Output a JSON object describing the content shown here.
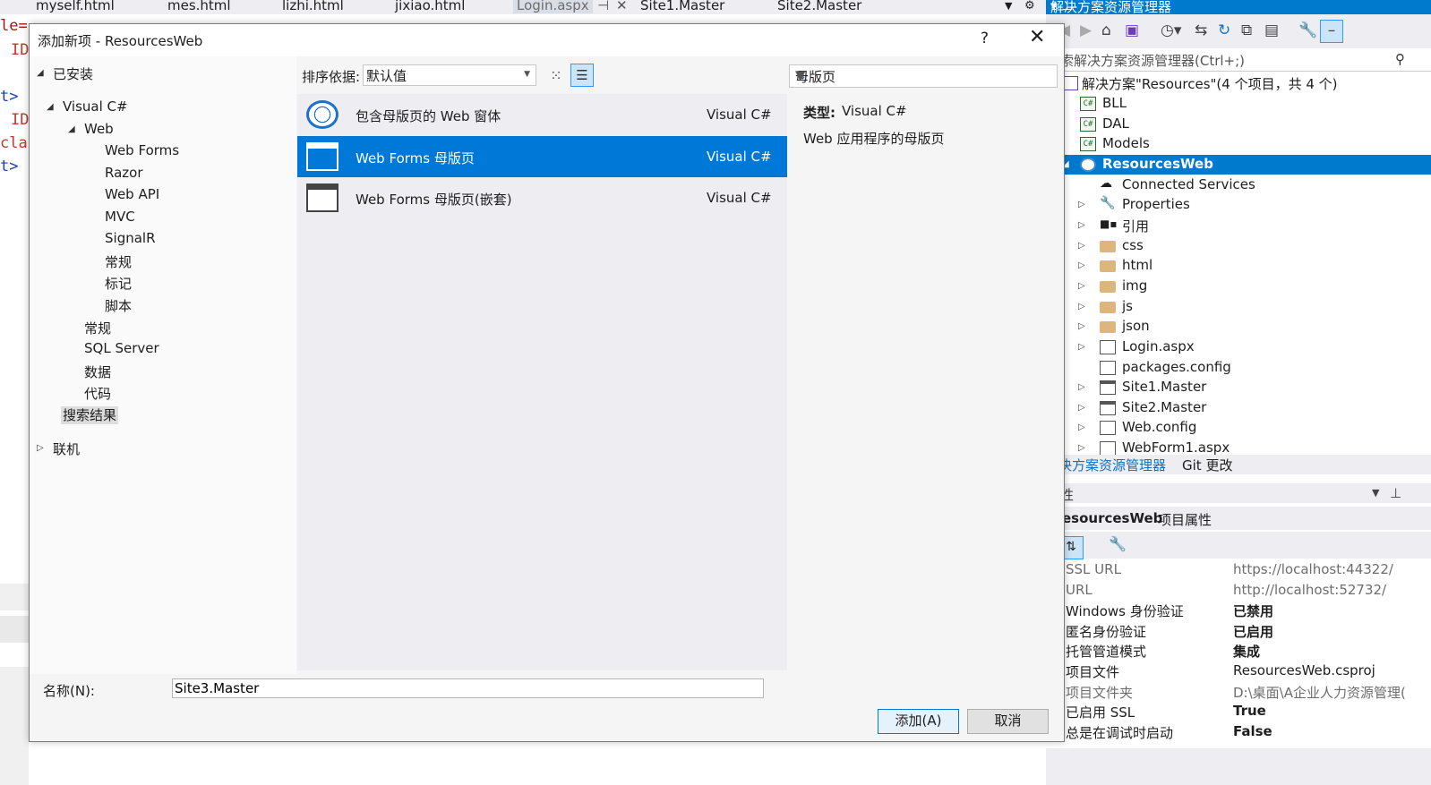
{
  "tabs": [
    "myself.html",
    "mes.html",
    "lizhi.html",
    "jixiao.html",
    "Login.aspx",
    "Site1.Master",
    "Site2.Master"
  ],
  "tabs_active_index": 4,
  "editor_fragments": [
    "le=\"\"  I",
    "ID",
    "t>",
    "ID",
    "cla",
    "t>"
  ],
  "dialog": {
    "title": "添加新项 - ResourcesWeb",
    "help": "?",
    "close": "✕",
    "categories": {
      "installed": "已安装",
      "visual_csharp": "Visual C#",
      "web": "Web",
      "web_children": [
        "Web Forms",
        "Razor",
        "Web API",
        "MVC",
        "SignalR",
        "常规",
        "标记",
        "脚本"
      ],
      "csharp_children": [
        "常规",
        "SQL Server",
        "数据",
        "代码"
      ],
      "search_results": "搜索结果",
      "online": "联机"
    },
    "sort_label": "排序依据:",
    "sort_value": "默认值",
    "templates": [
      {
        "name": "包含母版页的 Web 窗体",
        "lang": "Visual C#",
        "icon": "globe-icon"
      },
      {
        "name": "Web Forms 母版页",
        "lang": "Visual C#",
        "icon": "master-page-icon"
      },
      {
        "name": "Web Forms 母版页(嵌套)",
        "lang": "Visual C#",
        "icon": "master-page-icon"
      }
    ],
    "selected_template_index": 1,
    "search_value": "母版页",
    "desc_type_label": "类型:",
    "desc_type_value": "Visual C#",
    "desc_text": "Web 应用程序的母版页",
    "name_label": "名称(N):",
    "name_value": "Site3.Master",
    "add_button": "添加(A)",
    "cancel_button": "取消"
  },
  "solution_explorer": {
    "title": "解决方案资源管理器",
    "search_placeholder": "索解决方案资源管理器(Ctrl+;)",
    "solution": "解决方案\"Resources\"(4 个项目，共 4 个)",
    "projects": [
      "BLL",
      "DAL",
      "Models"
    ],
    "selected_project": "ResourcesWeb",
    "children": [
      "Connected Services",
      "Properties",
      "引用",
      "css",
      "html",
      "img",
      "js",
      "json",
      "Login.aspx",
      "packages.config",
      "Site1.Master",
      "Site2.Master",
      "Web.config",
      "WebForm1.aspx"
    ],
    "tab_solution": "决方案资源管理器",
    "tab_git": "Git 更改"
  },
  "properties": {
    "header": "性",
    "object_name": "esourcesWeb",
    "object_type": "项目属性",
    "rows": [
      {
        "key": "SSL URL",
        "value": "https://localhost:44322/"
      },
      {
        "key": "URL",
        "value": "http://localhost:52732/"
      },
      {
        "key": "Windows 身份验证",
        "value": "已禁用"
      },
      {
        "key": "匿名身份验证",
        "value": "已启用"
      },
      {
        "key": "托管管道模式",
        "value": "集成"
      },
      {
        "key": "项目文件",
        "value": "ResourcesWeb.csproj"
      },
      {
        "key": "项目文件夹",
        "value": "D:\\桌面\\A企业人力资源管理("
      },
      {
        "key": "已启用 SSL",
        "value": "True"
      },
      {
        "key": "总是在调试时启动",
        "value": "False"
      }
    ]
  },
  "colors": {
    "accent": "#007acc",
    "selection": "#0078d7"
  }
}
